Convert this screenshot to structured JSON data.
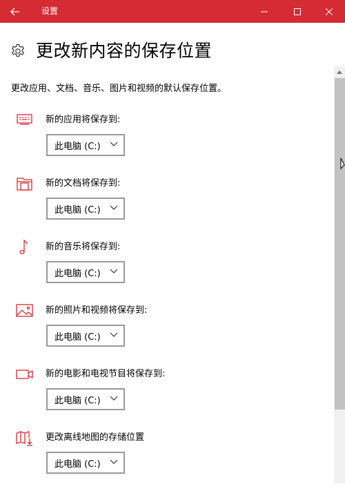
{
  "window": {
    "title": "设置"
  },
  "header": {
    "title": "更改新内容的保存位置"
  },
  "description": "更改应用、文档、音乐、图片和视频的默认保存位置。",
  "sections": [
    {
      "icon": "monitor-icon",
      "label": "新的应用将保存到:",
      "value": "此电脑 (C:)"
    },
    {
      "icon": "folder-icon",
      "label": "新的文档将保存到:",
      "value": "此电脑 (C:)"
    },
    {
      "icon": "music-note-icon",
      "label": "新的音乐将保存到:",
      "value": "此电脑 (C:)"
    },
    {
      "icon": "picture-icon",
      "label": "新的照片和视频将保存到:",
      "value": "此电脑 (C:)"
    },
    {
      "icon": "video-camera-icon",
      "label": "新的电影和电视节目将保存到:",
      "value": "此电脑 (C:)"
    },
    {
      "icon": "offline-map-icon",
      "label": "更改离线地图的存储位置",
      "value": "此电脑 (C:)"
    }
  ],
  "colors": {
    "accent": "#d52b33",
    "icon": "#d52b33",
    "border": "#999999"
  }
}
